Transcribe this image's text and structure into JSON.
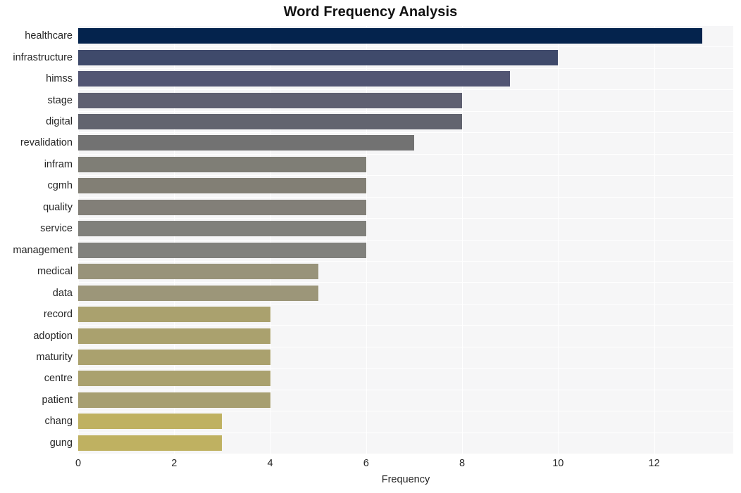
{
  "chart_data": {
    "type": "bar",
    "orientation": "horizontal",
    "title": "Word Frequency Analysis",
    "xlabel": "Frequency",
    "ylabel": "",
    "xlim": [
      0,
      13.65
    ],
    "xticks": [
      0,
      2,
      4,
      6,
      8,
      10,
      12
    ],
    "grid": true,
    "legend": "none",
    "categories": [
      "healthcare",
      "infrastructure",
      "himss",
      "stage",
      "digital",
      "revalidation",
      "infram",
      "cgmh",
      "quality",
      "service",
      "management",
      "medical",
      "data",
      "record",
      "adoption",
      "maturity",
      "centre",
      "patient",
      "chang",
      "gung"
    ],
    "values": [
      13,
      10,
      9,
      8,
      8,
      7,
      6,
      6,
      6,
      6,
      6,
      5,
      5,
      4,
      4,
      4,
      4,
      4,
      3,
      3
    ],
    "bar_colors": [
      "#04234d",
      "#3f4a6b",
      "#525573",
      "#5f6071",
      "#62646f",
      "#727272",
      "#7f7e76",
      "#827f75",
      "#827f78",
      "#80807b",
      "#81817d",
      "#98937a",
      "#9c9679",
      "#aaa16e",
      "#aaa16e",
      "#aaa16e",
      "#aaa16e",
      "#a79f71",
      "#bfb161",
      "#bfb161"
    ],
    "plot_background": "#f6f6f7",
    "gridline_color": "#ffffff",
    "page_background": "#ffffff"
  }
}
